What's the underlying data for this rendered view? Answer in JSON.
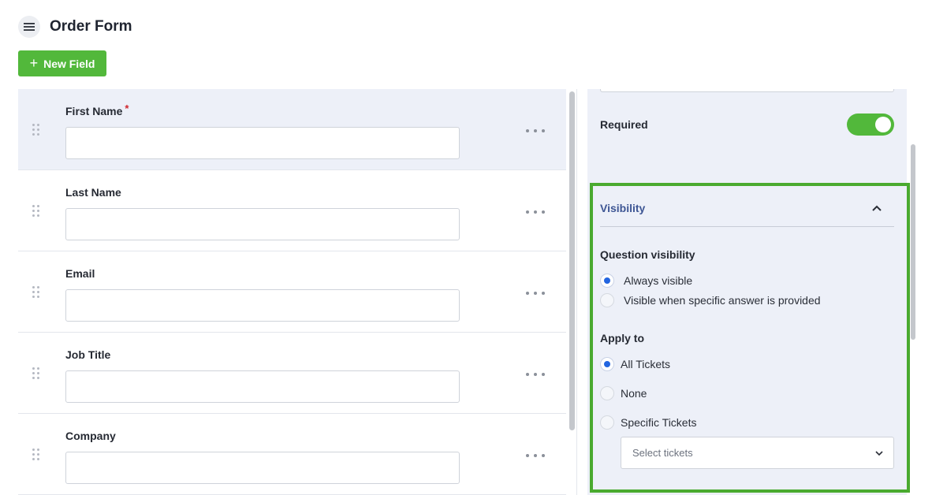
{
  "header": {
    "title": "Order Form",
    "menu_icon": "hamburger-menu-icon",
    "new_field_label": "New Field",
    "new_field_icon": "plus-icon"
  },
  "colors": {
    "primary_green": "#52b83b",
    "highlight_border": "#4aaa2f",
    "radio_blue": "#2365e0",
    "section_link": "#3e5694",
    "required_star": "#d0262d"
  },
  "fields": [
    {
      "label": "First Name",
      "required": true,
      "value": ""
    },
    {
      "label": "Last Name",
      "required": false,
      "value": ""
    },
    {
      "label": "Email",
      "required": false,
      "value": ""
    },
    {
      "label": "Job Title",
      "required": false,
      "value": ""
    },
    {
      "label": "Company",
      "required": false,
      "value": ""
    }
  ],
  "required_star": "*",
  "settings": {
    "required_label": "Required",
    "required_on": true,
    "visibility": {
      "title": "Visibility",
      "question_visibility": {
        "title": "Question visibility",
        "options": [
          "Always visible",
          "Visible when specific answer is provided"
        ],
        "selected": "Always visible"
      },
      "apply_to": {
        "title": "Apply to",
        "options": [
          "All Tickets",
          "None",
          "Specific Tickets"
        ],
        "selected": "All Tickets",
        "tickets_placeholder": "Select tickets"
      }
    }
  }
}
